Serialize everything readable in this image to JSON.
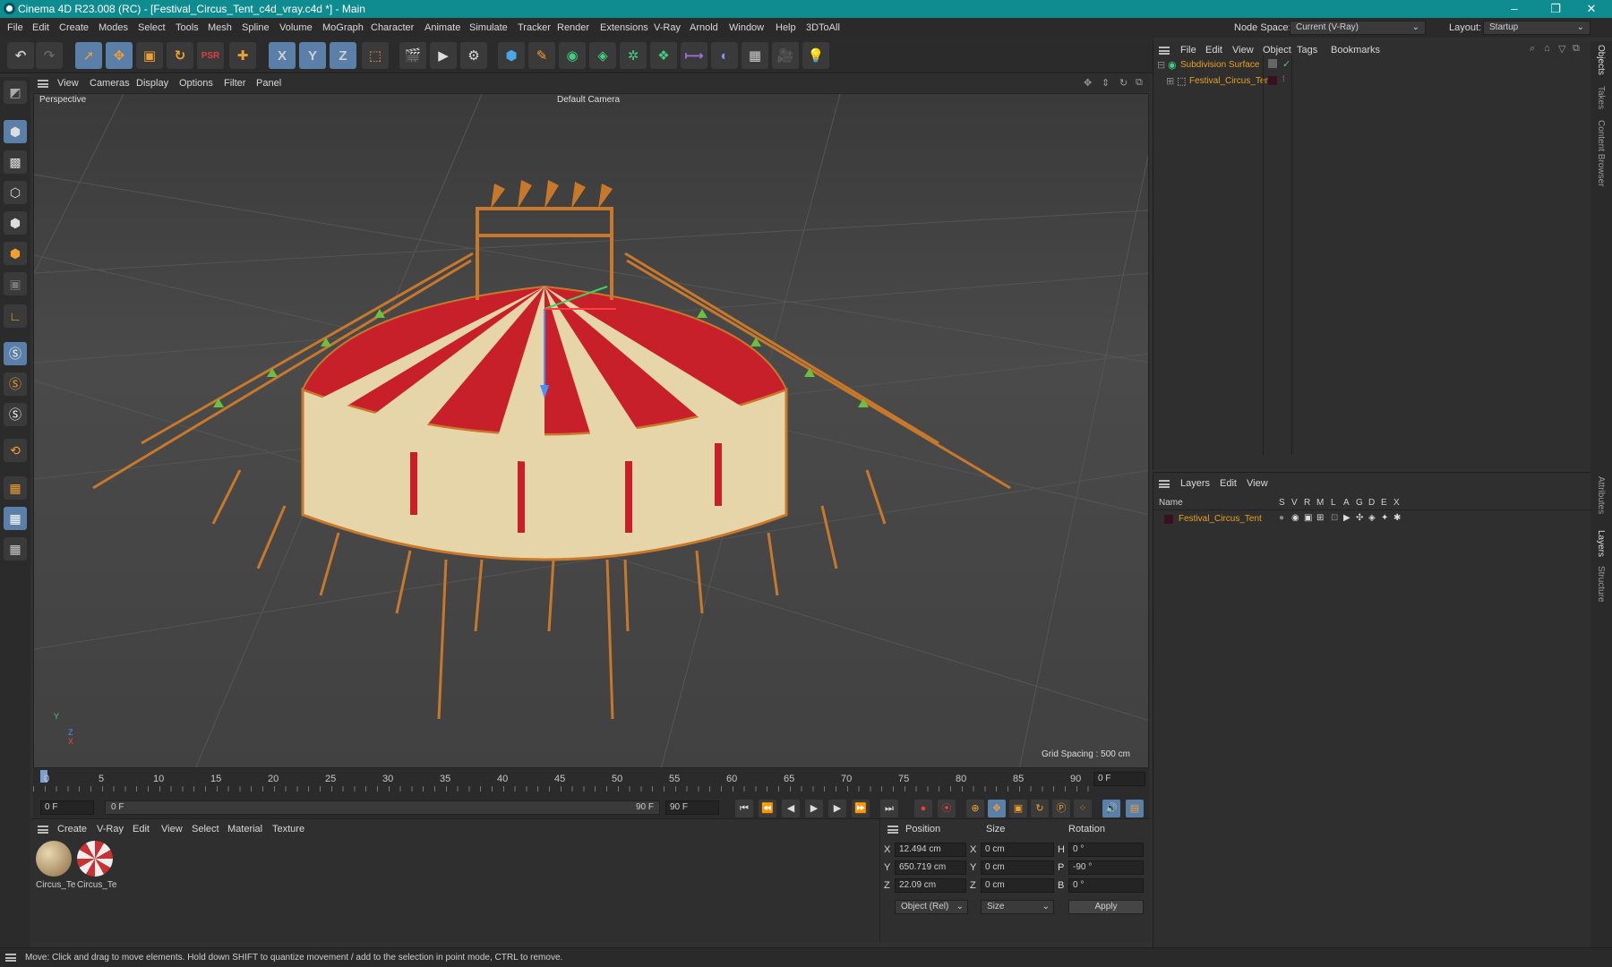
{
  "window": {
    "title": "Cinema 4D R23.008 (RC) - [Festival_Circus_Tent_c4d_vray.c4d *] - Main",
    "controls": [
      "–",
      "❐",
      "✕"
    ]
  },
  "menu": [
    "File",
    "Edit",
    "Create",
    "Modes",
    "Select",
    "Tools",
    "Mesh",
    "Spline",
    "Volume",
    "MoGraph",
    "Character",
    "Animate",
    "Simulate",
    "Tracker",
    "Render",
    "Extensions",
    "V-Ray",
    "Arnold",
    "Window",
    "Help",
    "3DToAll"
  ],
  "node_space": {
    "label": "Node Space:",
    "value": "Current (V-Ray)"
  },
  "layout": {
    "label": "Layout:",
    "value": "Startup"
  },
  "toolbar": {
    "icons": [
      "undo-icon",
      "redo-icon",
      "select-icon",
      "move-icon",
      "scale-icon",
      "rotate-icon",
      "psr-icon",
      "add-icon",
      "x-axis-icon",
      "y-axis-icon",
      "z-axis-icon",
      "coord-system-icon",
      "render-region-icon",
      "render-view-icon",
      "render-settings-icon",
      "cube-icon",
      "pen-icon",
      "subdivision-icon",
      "extrude-icon",
      "cloner-icon",
      "instance-icon",
      "deformer-icon",
      "sphere-field-icon",
      "floor-icon",
      "camera-icon",
      "light-icon"
    ],
    "axis_labels": [
      "X",
      "Y",
      "Z"
    ]
  },
  "viewport": {
    "menu": [
      "View",
      "Cameras",
      "Display",
      "Options",
      "Filter",
      "Panel"
    ],
    "name": "Perspective",
    "camera": "Default Camera",
    "grid_spacing": "Grid Spacing : 500 cm",
    "axis": {
      "x": "X",
      "y": "Y",
      "z": "Z"
    }
  },
  "timeline": {
    "ticks": [
      "0",
      "5",
      "10",
      "15",
      "20",
      "25",
      "30",
      "35",
      "40",
      "45",
      "50",
      "55",
      "60",
      "65",
      "70",
      "75",
      "80",
      "85",
      "90"
    ],
    "current_frame": "0 F",
    "start": "0 F",
    "range_start": "0 F",
    "range_end": "90 F",
    "end": "90 F"
  },
  "materials": {
    "menu": [
      "Create",
      "V-Ray",
      "Edit",
      "View",
      "Select",
      "Material",
      "Texture"
    ],
    "items": [
      {
        "label": "Circus_Te",
        "color": "#b89a70"
      },
      {
        "label": "Circus_Te",
        "color": "#c83232"
      }
    ]
  },
  "coordinates": {
    "headers": [
      "Position",
      "Size",
      "Rotation"
    ],
    "rows": [
      {
        "axis": "X",
        "pos": "12.494 cm",
        "size_axis": "X",
        "size": "0 cm",
        "rot_axis": "H",
        "rot": "0 °"
      },
      {
        "axis": "Y",
        "pos": "650.719 cm",
        "size_axis": "Y",
        "size": "0 cm",
        "rot_axis": "P",
        "rot": "-90 °"
      },
      {
        "axis": "Z",
        "pos": "22.09 cm",
        "size_axis": "Z",
        "size": "0 cm",
        "rot_axis": "B",
        "rot": "0 °"
      }
    ],
    "mode": "Object (Rel)",
    "size_mode": "Size",
    "apply": "Apply"
  },
  "objects": {
    "menu": [
      "File",
      "Edit",
      "View",
      "Object",
      "Tags",
      "Bookmarks"
    ],
    "tree": [
      {
        "name": "Subdivision Surface",
        "color": "#e8a020"
      },
      {
        "name": "Festival_Circus_Tent",
        "color": "#e8a020"
      }
    ]
  },
  "layers": {
    "menu": [
      "Layers",
      "Edit",
      "View"
    ],
    "columns": [
      "Name",
      "S",
      "V",
      "R",
      "M",
      "L",
      "A",
      "G",
      "D",
      "E",
      "X"
    ],
    "items": [
      {
        "name": "Festival_Circus_Tent",
        "color": "#3a0f22"
      }
    ]
  },
  "side_tabs": [
    "Objects",
    "Takes",
    "Content Browser",
    "Attributes",
    "Layers",
    "Structure"
  ],
  "status": "Move: Click and drag to move elements. Hold down SHIFT to quantize movement / add to the selection in point mode, CTRL to remove.",
  "colors": {
    "titlebar": "#0f8c8f",
    "accent": "#5a7fa8",
    "object_name": "#e8a020",
    "tent_red": "#c8202a",
    "tent_cream": "#e6d5a8",
    "rigging": "#c8782a"
  }
}
